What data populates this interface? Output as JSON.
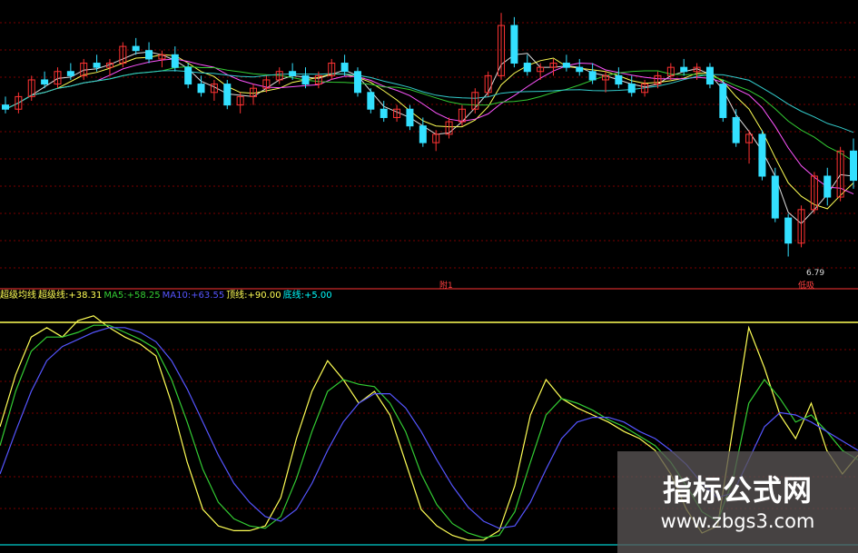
{
  "legend": [
    {
      "label": "超级均线",
      "value": "",
      "color": "#ffff55"
    },
    {
      "label": "超级线:",
      "value": "+38.31",
      "color": "#ffff55"
    },
    {
      "label": "MA5:",
      "value": "+58.25",
      "color": "#33cc33"
    },
    {
      "label": "MA10:",
      "value": "+63.55",
      "color": "#5555ff"
    },
    {
      "label": "顶线:",
      "value": "+90.00",
      "color": "#ffff55"
    },
    {
      "label": "底线:",
      "value": "+5.00",
      "color": "#00ffff"
    }
  ],
  "annotations": {
    "low_price": "6.79",
    "bottom_tag": "低吸",
    "divider_tag": "附1"
  },
  "watermark": {
    "title": "指标公式网",
    "url": "www.zbgs3.com"
  },
  "colors": {
    "up_candle": "#ff3333",
    "down_candle": "#33e0ff",
    "grid": "#7a0000",
    "divider": "#ff3333",
    "top_line": "#ffff55",
    "bottom_line": "#00ffff"
  },
  "chart_data": [
    {
      "type": "candlestick",
      "title": "",
      "xlabel": "",
      "ylabel": "",
      "grid": true,
      "moving_averages": [
        "white",
        "yellow",
        "magenta",
        "green",
        "cyan"
      ],
      "ohlc": [
        [
          8.6,
          8.7,
          8.5,
          8.55
        ],
        [
          8.55,
          8.75,
          8.5,
          8.7
        ],
        [
          8.7,
          8.95,
          8.65,
          8.9
        ],
        [
          8.9,
          9.0,
          8.8,
          8.85
        ],
        [
          8.85,
          9.05,
          8.8,
          9.0
        ],
        [
          9.0,
          9.1,
          8.9,
          8.95
        ],
        [
          8.95,
          9.15,
          8.9,
          9.1
        ],
        [
          9.1,
          9.2,
          9.0,
          9.05
        ],
        [
          9.05,
          9.15,
          8.95,
          9.1
        ],
        [
          9.1,
          9.35,
          9.05,
          9.3
        ],
        [
          9.3,
          9.4,
          9.2,
          9.25
        ],
        [
          9.25,
          9.35,
          9.1,
          9.15
        ],
        [
          9.15,
          9.25,
          9.05,
          9.2
        ],
        [
          9.2,
          9.3,
          9.0,
          9.05
        ],
        [
          9.05,
          9.1,
          8.8,
          8.85
        ],
        [
          8.85,
          8.95,
          8.7,
          8.75
        ],
        [
          8.75,
          8.9,
          8.65,
          8.85
        ],
        [
          8.85,
          8.9,
          8.55,
          8.6
        ],
        [
          8.6,
          8.75,
          8.5,
          8.7
        ],
        [
          8.7,
          8.85,
          8.6,
          8.8
        ],
        [
          8.8,
          8.95,
          8.75,
          8.9
        ],
        [
          8.9,
          9.05,
          8.85,
          9.0
        ],
        [
          9.0,
          9.1,
          8.9,
          8.95
        ],
        [
          8.95,
          9.05,
          8.8,
          8.85
        ],
        [
          8.85,
          9.0,
          8.8,
          8.95
        ],
        [
          8.95,
          9.15,
          8.9,
          9.1
        ],
        [
          9.1,
          9.2,
          8.95,
          9.0
        ],
        [
          9.0,
          9.05,
          8.7,
          8.75
        ],
        [
          8.75,
          8.8,
          8.5,
          8.55
        ],
        [
          8.55,
          8.65,
          8.4,
          8.45
        ],
        [
          8.45,
          8.6,
          8.4,
          8.55
        ],
        [
          8.55,
          8.6,
          8.3,
          8.35
        ],
        [
          8.35,
          8.45,
          8.1,
          8.15
        ],
        [
          8.15,
          8.3,
          8.05,
          8.25
        ],
        [
          8.25,
          8.45,
          8.2,
          8.4
        ],
        [
          8.4,
          8.6,
          8.35,
          8.55
        ],
        [
          8.55,
          8.8,
          8.5,
          8.75
        ],
        [
          8.75,
          9.0,
          8.7,
          8.95
        ],
        [
          8.95,
          9.7,
          8.9,
          9.55
        ],
        [
          9.55,
          9.65,
          9.05,
          9.1
        ],
        [
          9.1,
          9.2,
          8.95,
          9.0
        ],
        [
          9.0,
          9.1,
          8.9,
          9.05
        ],
        [
          9.05,
          9.15,
          8.95,
          9.1
        ],
        [
          9.1,
          9.2,
          9.0,
          9.05
        ],
        [
          9.05,
          9.15,
          8.95,
          9.0
        ],
        [
          9.0,
          9.1,
          8.85,
          8.9
        ],
        [
          8.9,
          9.0,
          8.75,
          8.95
        ],
        [
          8.95,
          9.05,
          8.8,
          8.85
        ],
        [
          8.85,
          8.95,
          8.7,
          8.75
        ],
        [
          8.75,
          8.9,
          8.7,
          8.85
        ],
        [
          8.85,
          9.0,
          8.8,
          8.95
        ],
        [
          8.95,
          9.1,
          8.9,
          9.05
        ],
        [
          9.05,
          9.15,
          8.95,
          9.0
        ],
        [
          9.0,
          9.1,
          8.9,
          9.05
        ],
        [
          9.05,
          9.1,
          8.8,
          8.85
        ],
        [
          8.85,
          8.9,
          8.4,
          8.45
        ],
        [
          8.45,
          8.55,
          8.1,
          8.15
        ],
        [
          8.15,
          8.3,
          7.9,
          8.25
        ],
        [
          8.25,
          8.3,
          7.7,
          7.75
        ],
        [
          7.75,
          7.85,
          7.2,
          7.25
        ],
        [
          7.25,
          7.3,
          6.79,
          6.95
        ],
        [
          6.95,
          7.4,
          6.9,
          7.35
        ],
        [
          7.35,
          7.8,
          7.3,
          7.75
        ],
        [
          7.75,
          7.85,
          7.4,
          7.5
        ],
        [
          7.5,
          8.1,
          7.45,
          8.05
        ],
        [
          8.05,
          8.2,
          7.6,
          7.7
        ]
      ],
      "low_marker": "6.79"
    },
    {
      "type": "line",
      "title": "",
      "xlabel": "",
      "ylabel": "",
      "ylim": [
        0,
        100
      ],
      "grid": true,
      "reference_lines": [
        {
          "name": "顶线",
          "y": 90
        },
        {
          "name": "底线",
          "y": 5
        }
      ],
      "series": [
        {
          "name": "超级线",
          "color": "#ffff55",
          "values": [
            50,
            72,
            88,
            92,
            88,
            95,
            97,
            92,
            88,
            85,
            80,
            60,
            35,
            15,
            8,
            6,
            6,
            8,
            20,
            45,
            65,
            78,
            70,
            60,
            65,
            55,
            35,
            15,
            8,
            4,
            2,
            2,
            6,
            25,
            55,
            70,
            62,
            58,
            55,
            52,
            48,
            45,
            40,
            30,
            15,
            5,
            8,
            50,
            92,
            75,
            55,
            45,
            60,
            40,
            30,
            38
          ]
        },
        {
          "name": "MA5",
          "color": "#33cc33",
          "values": [
            42,
            65,
            82,
            88,
            88,
            90,
            93,
            93,
            90,
            87,
            83,
            70,
            52,
            32,
            18,
            11,
            8,
            7,
            12,
            28,
            48,
            65,
            70,
            68,
            67,
            60,
            48,
            30,
            17,
            9,
            5,
            3,
            4,
            14,
            35,
            55,
            62,
            60,
            57,
            53,
            50,
            46,
            42,
            35,
            25,
            14,
            10,
            28,
            60,
            70,
            62,
            52,
            55,
            48,
            40,
            36
          ]
        },
        {
          "name": "MA10",
          "color": "#5555ff",
          "values": [
            30,
            48,
            65,
            78,
            84,
            87,
            90,
            92,
            92,
            90,
            86,
            78,
            66,
            52,
            38,
            26,
            18,
            12,
            10,
            15,
            26,
            40,
            52,
            60,
            64,
            64,
            58,
            48,
            36,
            25,
            16,
            10,
            7,
            8,
            18,
            32,
            45,
            52,
            54,
            54,
            52,
            48,
            45,
            40,
            34,
            26,
            20,
            22,
            36,
            50,
            56,
            55,
            52,
            48,
            44,
            40
          ]
        }
      ]
    }
  ]
}
